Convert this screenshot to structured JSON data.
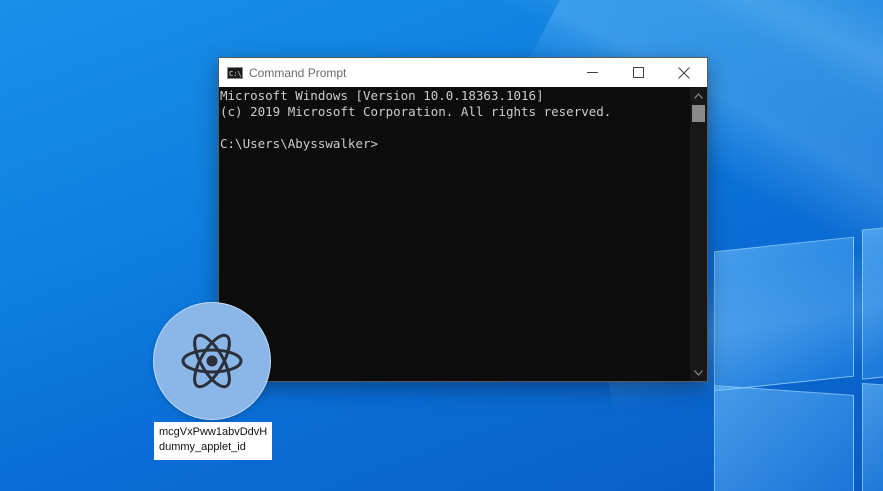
{
  "colors": {
    "desktop_background": "#0f7fe0",
    "console_background": "#0c0c0c",
    "console_text": "#cccccc",
    "titlebar": "#ffffff",
    "applet_circle": "#8ab6e8"
  },
  "window": {
    "title": "Command Prompt",
    "icon": "cmd-icon",
    "icon_text": "C:\\",
    "controls": {
      "minimize": "minimize-icon",
      "maximize": "maximize-icon",
      "close": "close-icon"
    }
  },
  "console": {
    "lines": [
      "Microsoft Windows [Version 10.0.18363.1016]",
      "(c) 2019 Microsoft Corporation. All rights reserved.",
      "",
      "C:\\Users\\Abysswalker>"
    ]
  },
  "applet": {
    "icon": "react-atom-icon",
    "label_line1": "mcgVxPww1abvDdvH",
    "label_line2": "dummy_applet_id"
  }
}
